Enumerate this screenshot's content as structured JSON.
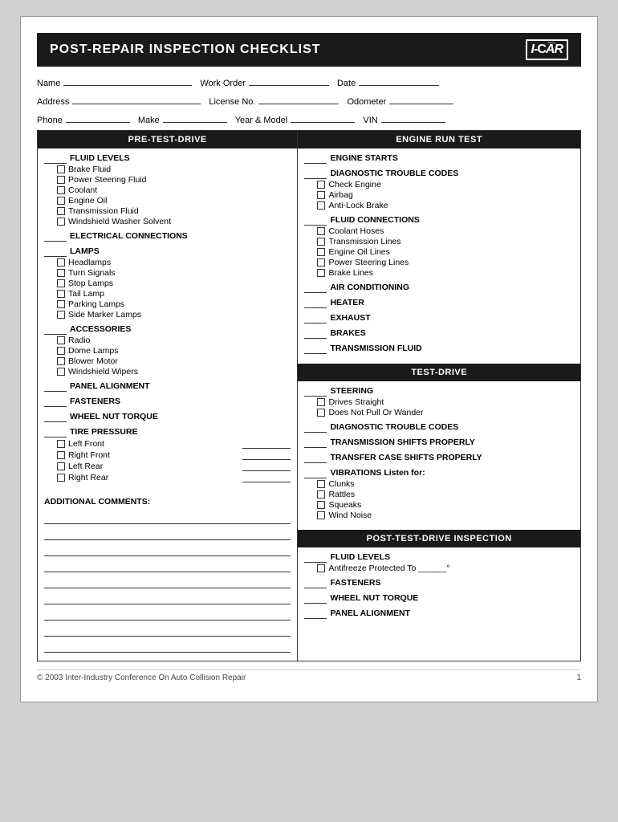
{
  "page": {
    "title": "POST-REPAIR INSPECTION CHECKLIST",
    "logo": "I-CAR",
    "footer_left": "© 2003 Inter-Industry Conference On Auto Collision Repair",
    "footer_right": "1"
  },
  "header_fields": {
    "name_label": "Name",
    "work_order_label": "Work Order",
    "date_label": "Date",
    "address_label": "Address",
    "license_label": "License No.",
    "odometer_label": "Odometer",
    "phone_label": "Phone",
    "make_label": "Make",
    "year_model_label": "Year & Model",
    "vin_label": "VIN"
  },
  "left_column": {
    "header": "PRE-TEST-DRIVE",
    "sections": [
      {
        "type": "blank-group",
        "label": "FLUID LEVELS",
        "items": [
          "Brake Fluid",
          "Power Steering Fluid",
          "Coolant",
          "Engine Oil",
          "Transmission Fluid",
          "Windshield Washer Solvent"
        ]
      },
      {
        "type": "blank-single",
        "label": "ELECTRICAL CONNECTIONS"
      },
      {
        "type": "blank-group",
        "label": "LAMPS",
        "items": [
          "Headlamps",
          "Turn Signals",
          "Stop Lamps",
          "Tail Lamp",
          "Parking Lamps",
          "Side Marker Lamps"
        ]
      },
      {
        "type": "blank-group",
        "label": "ACCESSORIES",
        "items": [
          "Radio",
          "Dome Lamps",
          "Blower Motor",
          "Windshield Wipers"
        ]
      },
      {
        "type": "blank-single",
        "label": "PANEL ALIGNMENT"
      },
      {
        "type": "blank-single",
        "label": "FASTENERS"
      },
      {
        "type": "blank-single",
        "label": "WHEEL NUT TORQUE"
      },
      {
        "type": "tire-pressure",
        "label": "TIRE PRESSURE",
        "tires": [
          "Left Front",
          "Right Front",
          "Left Rear",
          "Right Rear"
        ]
      }
    ],
    "comments_label": "ADDITIONAL COMMENTS:"
  },
  "right_column": {
    "sections": [
      {
        "header": "ENGINE RUN TEST",
        "items": [
          {
            "type": "blank-single",
            "label": "ENGINE STARTS"
          },
          {
            "type": "blank-group",
            "label": "DIAGNOSTIC TROUBLE CODES",
            "items": [
              "Check Engine",
              "Airbag",
              "Anti-Lock Brake"
            ]
          },
          {
            "type": "blank-group",
            "label": "FLUID CONNECTIONS",
            "items": [
              "Coolant Hoses",
              "Transmission Lines",
              "Engine Oil Lines",
              "Power Steering Lines",
              "Brake Lines"
            ]
          },
          {
            "type": "blank-single",
            "label": "AIR CONDITIONING"
          },
          {
            "type": "blank-single",
            "label": "HEATER"
          },
          {
            "type": "blank-single",
            "label": "EXHAUST"
          },
          {
            "type": "blank-single",
            "label": "BRAKES"
          },
          {
            "type": "blank-single",
            "label": "TRANSMISSION FLUID"
          }
        ]
      },
      {
        "header": "TEST-DRIVE",
        "items": [
          {
            "type": "blank-group",
            "label": "STEERING",
            "items": [
              "Drives Straight",
              "Does Not Pull Or Wander"
            ]
          },
          {
            "type": "blank-single",
            "label": "DIAGNOSTIC TROUBLE CODES"
          },
          {
            "type": "blank-single",
            "label": "TRANSMISSION SHIFTS PROPERLY"
          },
          {
            "type": "blank-single",
            "label": "TRANSFER CASE SHIFTS PROPERLY"
          },
          {
            "type": "blank-group",
            "label": "VIBRATIONS Listen for:",
            "items": [
              "Clunks",
              "Rattles",
              "Squeaks",
              "Wind Noise"
            ]
          }
        ]
      },
      {
        "header": "POST-TEST-DRIVE INSPECTION",
        "items": [
          {
            "type": "blank-group-special",
            "label": "FLUID LEVELS",
            "items": [
              "Antifreeze Protected To ______°"
            ]
          },
          {
            "type": "blank-single",
            "label": "FASTENERS"
          },
          {
            "type": "blank-single",
            "label": "WHEEL NUT TORQUE"
          },
          {
            "type": "blank-single",
            "label": "PANEL ALIGNMENT"
          }
        ]
      }
    ]
  }
}
